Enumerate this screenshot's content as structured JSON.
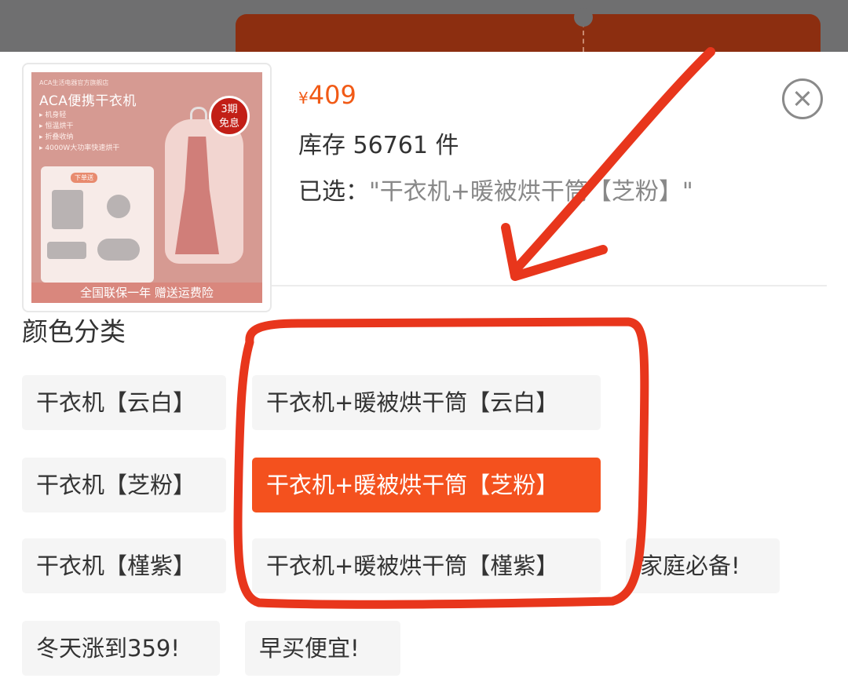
{
  "product": {
    "thumbnail": {
      "small_text": "ACA生活电器官方旗舰店",
      "title": "ACA便携干衣机",
      "bullets": [
        "机身轻",
        "恒温烘干",
        "折叠收纳",
        "4000W大功率快速烘干"
      ],
      "badge_line1": "3期",
      "badge_line2": "免息",
      "tag": "下单送",
      "footer": "全国联保一年 赠送运费险"
    },
    "price_symbol": "¥",
    "price_value": "409",
    "stock_text": "库存 56761 件",
    "selected_label": "已选：",
    "selected_value": "\"干衣机+暖被烘干筒【芝粉】\""
  },
  "options_section": {
    "title": "颜色分类",
    "options": [
      {
        "label": "干衣机【云白】",
        "selected": false
      },
      {
        "label": "干衣机+暖被烘干筒【云白】",
        "selected": false
      },
      {
        "label": "干衣机【芝粉】",
        "selected": false
      },
      {
        "label": "干衣机+暖被烘干筒【芝粉】",
        "selected": true
      },
      {
        "label": "干衣机【槿紫】",
        "selected": false
      },
      {
        "label": "干衣机+暖被烘干筒【槿紫】",
        "selected": false
      },
      {
        "label": "家庭必备!",
        "selected": false
      },
      {
        "label": "冬天涨到359!",
        "selected": false
      },
      {
        "label": "早买便宜!",
        "selected": false
      }
    ]
  },
  "colors": {
    "accent": "#f4511e",
    "price": "#f15a16",
    "annotation_red": "#e8361c",
    "chip_bg": "#f5f5f5"
  },
  "icons": {
    "close": "close-circle-icon",
    "annotation_arrow": "arrow-icon"
  }
}
